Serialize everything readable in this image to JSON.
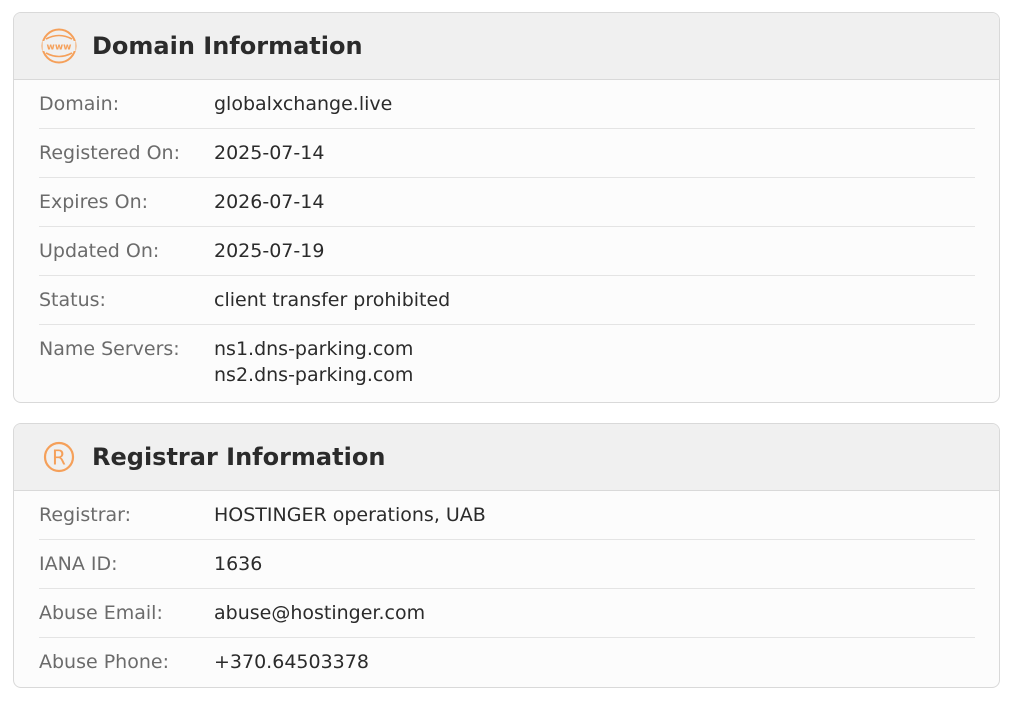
{
  "domain_section": {
    "title": "Domain Information",
    "icon": "www-globe-icon",
    "accent": "#f5a05a",
    "rows": [
      {
        "label": "Domain:",
        "value": "globalxchange.live"
      },
      {
        "label": "Registered On:",
        "value": "2025-07-14"
      },
      {
        "label": "Expires On:",
        "value": "2026-07-14"
      },
      {
        "label": "Updated On:",
        "value": "2025-07-19"
      },
      {
        "label": "Status:",
        "value": "client transfer prohibited"
      }
    ],
    "name_servers": {
      "label": "Name Servers:",
      "values": [
        "ns1.dns-parking.com",
        "ns2.dns-parking.com"
      ]
    }
  },
  "registrar_section": {
    "title": "Registrar Information",
    "icon": "registered-trademark-icon",
    "accent": "#f5a05a",
    "rows": [
      {
        "label": "Registrar:",
        "value": "HOSTINGER operations, UAB"
      },
      {
        "label": "IANA ID:",
        "value": "1636"
      },
      {
        "label": "Abuse Email:",
        "value": "abuse@hostinger.com"
      },
      {
        "label": "Abuse Phone:",
        "value": "+370.64503378"
      }
    ]
  }
}
